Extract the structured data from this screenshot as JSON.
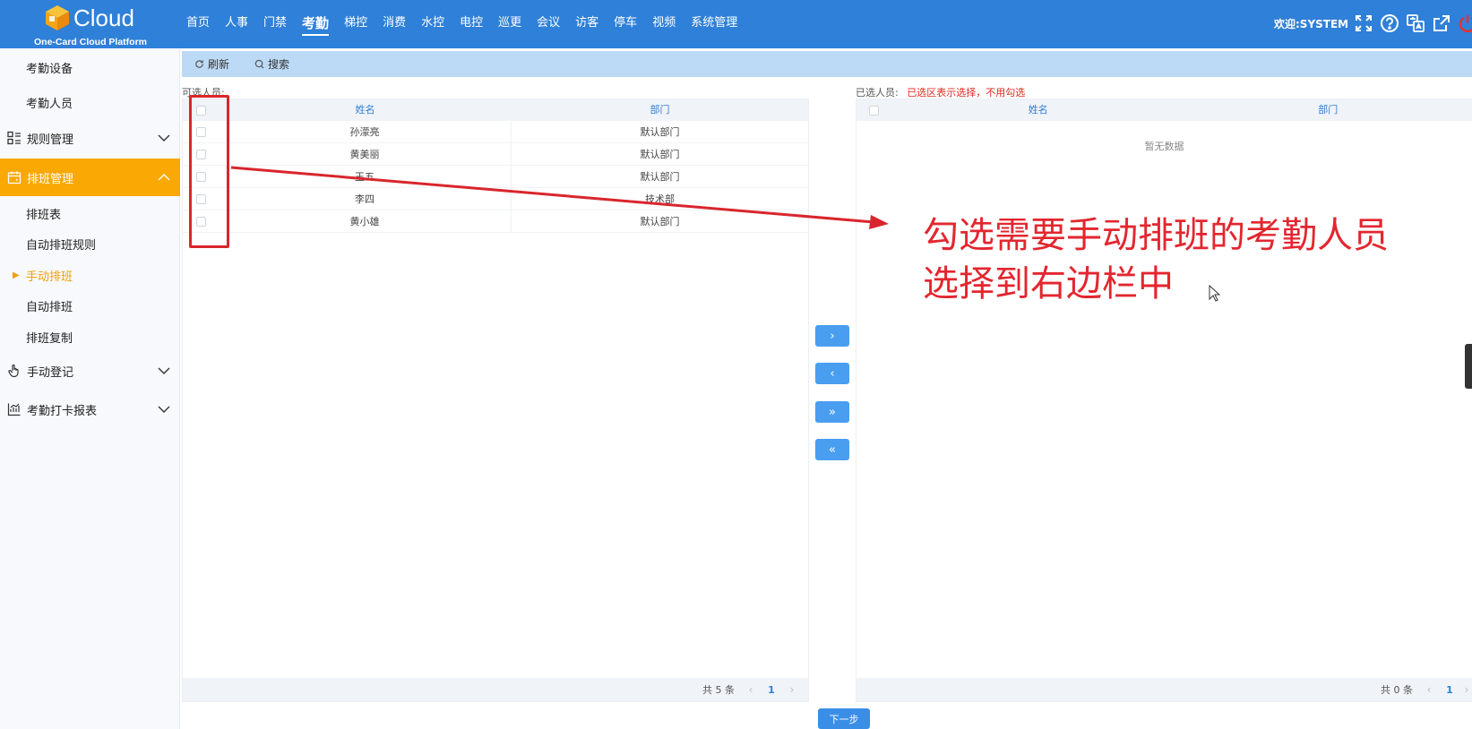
{
  "app": {
    "logo_text": "Cloud",
    "logo_sub": "One-Card Cloud Platform",
    "welcome": "欢迎:SYSTEM"
  },
  "nav": [
    {
      "label": "首页",
      "active": false
    },
    {
      "label": "人事",
      "active": false
    },
    {
      "label": "门禁",
      "active": false
    },
    {
      "label": "考勤",
      "active": true
    },
    {
      "label": "梯控",
      "active": false
    },
    {
      "label": "消费",
      "active": false
    },
    {
      "label": "水控",
      "active": false
    },
    {
      "label": "电控",
      "active": false
    },
    {
      "label": "巡更",
      "active": false
    },
    {
      "label": "会议",
      "active": false
    },
    {
      "label": "访客",
      "active": false
    },
    {
      "label": "停车",
      "active": false
    },
    {
      "label": "视频",
      "active": false
    },
    {
      "label": "系统管理",
      "active": false
    }
  ],
  "top_icons": [
    "fullscreen-icon",
    "help-icon",
    "language-icon",
    "external-link-icon",
    "power-icon"
  ],
  "sidebar": {
    "sub_top": [
      "考勤设备",
      "考勤人员"
    ],
    "rules": "规则管理",
    "schedule": "排班管理",
    "schedule_items": [
      "排班表",
      "自动排班规则",
      "手动排班",
      "自动排班",
      "排班复制"
    ],
    "manual_reg": "手动登记",
    "report": "考勤打卡报表"
  },
  "toolbar": {
    "refresh": "刷新",
    "search": "搜索"
  },
  "left_panel": {
    "label": "可选人员:",
    "col_name": "姓名",
    "col_dept": "部门",
    "rows": [
      {
        "name": "孙濛亮",
        "dept": "默认部门"
      },
      {
        "name": "黄美丽",
        "dept": "默认部门"
      },
      {
        "name": "王五",
        "dept": "默认部门"
      },
      {
        "name": "李四",
        "dept": "技术部"
      },
      {
        "name": "黄小雄",
        "dept": "默认部门"
      }
    ],
    "total": "共 5 条",
    "page": "1"
  },
  "right_panel": {
    "label": "已选人员:",
    "hint": "已选区表示选择，不用勾选",
    "col_name": "姓名",
    "col_dept": "部门",
    "empty": "暂无数据",
    "total": "共 0 条",
    "page": "1"
  },
  "transfer": {
    "move_right": "›",
    "move_left": "‹",
    "move_all_right": "»",
    "move_all_left": "«"
  },
  "next_button": "下一步",
  "annotation": {
    "line1": "勾选需要手动排班的考勤人员",
    "line2": "选择到右边栏中"
  },
  "colors": {
    "topbar": "#2f80d8",
    "active_group": "#f9a804",
    "toolbar": "#bcdaf5",
    "annotation": "#e3262f",
    "button": "#4a9ef0"
  }
}
